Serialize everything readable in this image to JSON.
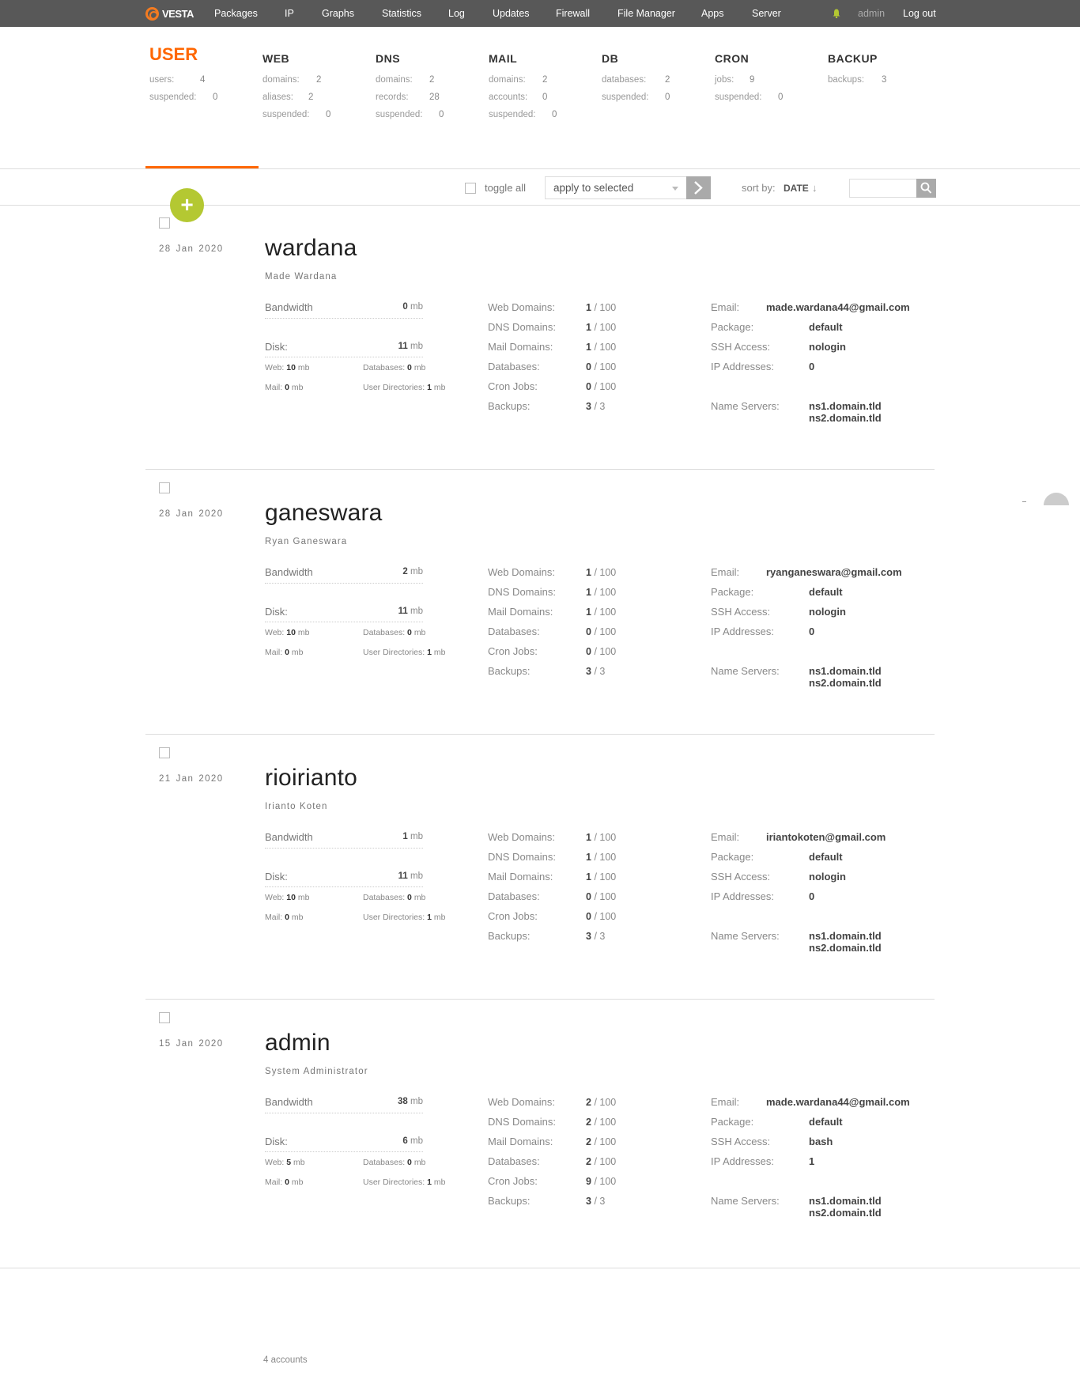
{
  "nav": {
    "logo": "VESTA",
    "items": [
      "Packages",
      "IP",
      "Graphs",
      "Statistics",
      "Log",
      "Updates",
      "Firewall",
      "File Manager",
      "Apps",
      "Server"
    ],
    "user": "admin",
    "logout": "Log out"
  },
  "stats": {
    "user": {
      "title": "USER",
      "rows": [
        {
          "k": "users:",
          "v": "4"
        },
        {
          "k": "suspended:",
          "v": "0"
        }
      ]
    },
    "web": {
      "title": "WEB",
      "rows": [
        {
          "k": "domains:",
          "v": "2"
        },
        {
          "k": "aliases:",
          "v": "2"
        },
        {
          "k": "suspended:",
          "v": "0"
        }
      ]
    },
    "dns": {
      "title": "DNS",
      "rows": [
        {
          "k": "domains:",
          "v": "2"
        },
        {
          "k": "records:",
          "v": "28"
        },
        {
          "k": "suspended:",
          "v": "0"
        }
      ]
    },
    "mail": {
      "title": "MAIL",
      "rows": [
        {
          "k": "domains:",
          "v": "2"
        },
        {
          "k": "accounts:",
          "v": "0"
        },
        {
          "k": "suspended:",
          "v": "0"
        }
      ]
    },
    "db": {
      "title": "DB",
      "rows": [
        {
          "k": "databases:",
          "v": "2"
        },
        {
          "k": "suspended:",
          "v": "0"
        }
      ]
    },
    "cron": {
      "title": "CRON",
      "rows": [
        {
          "k": "jobs:",
          "v": "9"
        },
        {
          "k": "suspended:",
          "v": "0"
        }
      ]
    },
    "backup": {
      "title": "BACKUP",
      "rows": [
        {
          "k": "backups:",
          "v": "3"
        }
      ]
    }
  },
  "toolbar": {
    "toggle_all": "toggle all",
    "apply_placeholder": "apply to selected",
    "sort_label": "sort by:",
    "sort_value": "DATE",
    "sort_arrow": "↓",
    "add_symbol": "+"
  },
  "labels": {
    "bandwidth": "Bandwidth",
    "disk": "Disk:",
    "web": "Web:",
    "databases": "Databases:",
    "mail": "Mail:",
    "user_dirs": "User Directories:",
    "mb": "mb",
    "web_domains": "Web Domains:",
    "dns_domains": "DNS Domains:",
    "mail_domains": "Mail Domains:",
    "databases_mid": "Databases:",
    "cron_jobs": "Cron Jobs:",
    "backups": "Backups:",
    "email": "Email:",
    "package": "Package:",
    "ssh": "SSH Access:",
    "ip": "IP Addresses:",
    "ns": "Name Servers:"
  },
  "users": [
    {
      "day": "28",
      "month": "Jan",
      "year": "2020",
      "name": "wardana",
      "full_name": "Made Wardana",
      "bandwidth": "0",
      "disk": "11",
      "web": "10",
      "db": "0",
      "mail": "0",
      "dirs": "1",
      "web_domains": "1",
      "web_domains_max": "/ 100",
      "dns_domains": "1",
      "dns_domains_max": "/ 100",
      "mail_domains": "1",
      "mail_domains_max": "/ 100",
      "databases": "0",
      "databases_max": "/ 100",
      "cron": "0",
      "cron_max": "/ 100",
      "backups": "3",
      "backups_max": "/ 3",
      "email": "made.wardana44@gmail.com",
      "package": "default",
      "ssh": "nologin",
      "ip": "0",
      "ns1": "ns1.domain.tld",
      "ns2": "ns2.domain.tld"
    },
    {
      "day": "28",
      "month": "Jan",
      "year": "2020",
      "name": "ganeswara",
      "full_name": "Ryan Ganeswara",
      "bandwidth": "2",
      "disk": "11",
      "web": "10",
      "db": "0",
      "mail": "0",
      "dirs": "1",
      "web_domains": "1",
      "web_domains_max": "/ 100",
      "dns_domains": "1",
      "dns_domains_max": "/ 100",
      "mail_domains": "1",
      "mail_domains_max": "/ 100",
      "databases": "0",
      "databases_max": "/ 100",
      "cron": "0",
      "cron_max": "/ 100",
      "backups": "3",
      "backups_max": "/ 3",
      "email": "ryanganeswara@gmail.com",
      "package": "default",
      "ssh": "nologin",
      "ip": "0",
      "ns1": "ns1.domain.tld",
      "ns2": "ns2.domain.tld"
    },
    {
      "day": "21",
      "month": "Jan",
      "year": "2020",
      "name": "rioirianto",
      "full_name": "Irianto Koten",
      "bandwidth": "1",
      "disk": "11",
      "web": "10",
      "db": "0",
      "mail": "0",
      "dirs": "1",
      "web_domains": "1",
      "web_domains_max": "/ 100",
      "dns_domains": "1",
      "dns_domains_max": "/ 100",
      "mail_domains": "1",
      "mail_domains_max": "/ 100",
      "databases": "0",
      "databases_max": "/ 100",
      "cron": "0",
      "cron_max": "/ 100",
      "backups": "3",
      "backups_max": "/ 3",
      "email": "iriantokoten@gmail.com",
      "package": "default",
      "ssh": "nologin",
      "ip": "0",
      "ns1": "ns1.domain.tld",
      "ns2": "ns2.domain.tld"
    },
    {
      "day": "15",
      "month": "Jan",
      "year": "2020",
      "name": "admin",
      "full_name": "System Administrator",
      "bandwidth": "38",
      "disk": "6",
      "web": "5",
      "db": "0",
      "mail": "0",
      "dirs": "1",
      "web_domains": "2",
      "web_domains_max": "/ 100",
      "dns_domains": "2",
      "dns_domains_max": "/ 100",
      "mail_domains": "2",
      "mail_domains_max": "/ 100",
      "databases": "2",
      "databases_max": "/ 100",
      "cron": "9",
      "cron_max": "/ 100",
      "backups": "3",
      "backups_max": "/ 3",
      "email": "made.wardana44@gmail.com",
      "package": "default",
      "ssh": "bash",
      "ip": "1",
      "ns1": "ns1.domain.tld",
      "ns2": "ns2.domain.tld"
    }
  ],
  "footer": {
    "count": "4 accounts"
  },
  "colors": {
    "accent": "#ff6701",
    "add_button": "#b4c832",
    "nav_bg": "#585858"
  }
}
